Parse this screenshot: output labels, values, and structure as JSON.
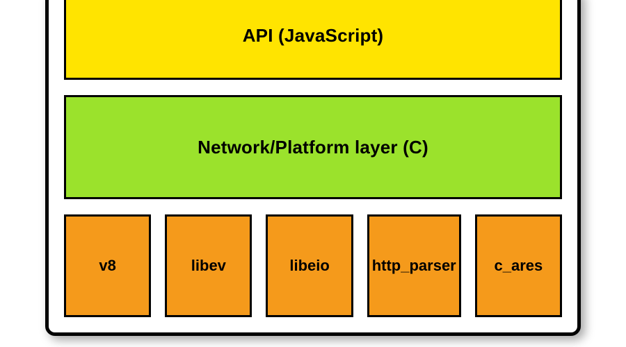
{
  "colors": {
    "api_bg": "#ffe400",
    "net_bg": "#9be22c",
    "lib_bg": "#f59a1b"
  },
  "layers": {
    "api_label": "API (JavaScript)",
    "network_label": "Network/Platform layer (C)"
  },
  "libs": [
    {
      "name": "v8"
    },
    {
      "name": "libev"
    },
    {
      "name": "libeio"
    },
    {
      "name": "http_parser"
    },
    {
      "name": "c_ares"
    }
  ]
}
